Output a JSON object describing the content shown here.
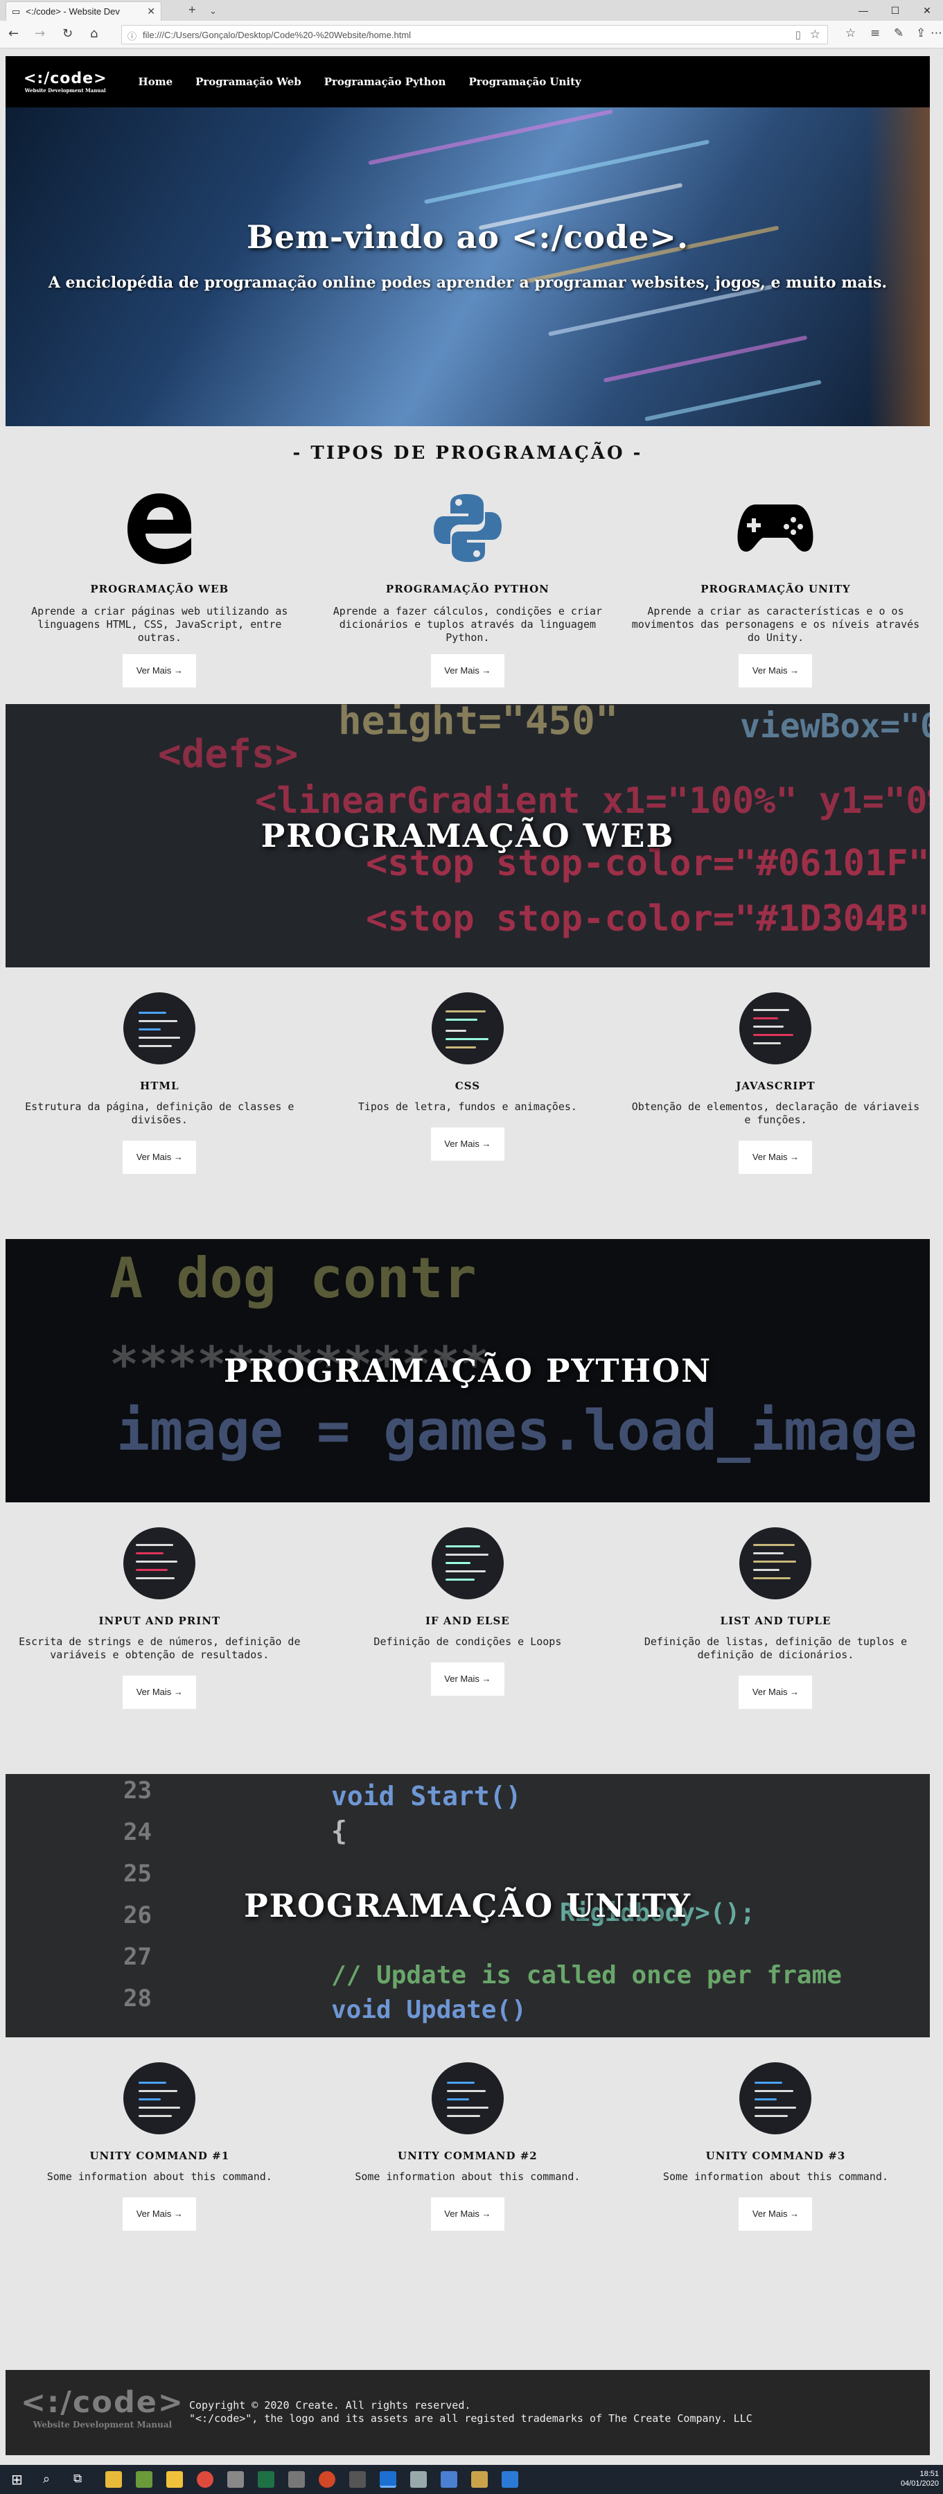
{
  "browser": {
    "tab_title": "<:/code> - Website Dev",
    "url": "file:///C:/Users/Gonçalo/Desktop/Code%20-%20Website/home.html"
  },
  "site": {
    "logo": {
      "title": "<:/code>",
      "subtitle": "Website Development Manual"
    },
    "nav": [
      "Home",
      "Programação Web",
      "Programação Python",
      "Programação Unity"
    ],
    "hero": {
      "title": "Bem-vindo ao <:/code>.",
      "subtitle": "A enciclopédia de programação online podes aprender a programar websites, jogos, e muito mais."
    },
    "types_heading": "- TIPOS DE PROGRAMAÇÃO -",
    "types": [
      {
        "icon": "edge-icon",
        "name": "PROGRAMAÇÃO WEB",
        "desc": "Aprende a criar páginas web utilizando as linguagens HTML, CSS, JavaScript, entre outras.",
        "button": "Ver Mais →"
      },
      {
        "icon": "python-icon",
        "name": "PROGRAMAÇÃO PYTHON",
        "desc": "Aprende a fazer cálculos, condições e criar dicionários e tuplos através da linguagem Python.",
        "button": "Ver Mais →"
      },
      {
        "icon": "gamepad-icon",
        "name": "PROGRAMAÇÃO UNITY",
        "desc": "Aprende a criar as características e o os movimentos das personagens e os níveis através do Unity.",
        "button": "Ver Mais →"
      }
    ],
    "web": {
      "banner": "PROGRAMAÇÃO WEB",
      "items": [
        {
          "name": "HTML",
          "desc": "Estrutura da página, definição de classes e divisões.",
          "button": "Ver Mais →"
        },
        {
          "name": "CSS",
          "desc": "Tipos de letra, fundos e animações.",
          "button": "Ver Mais →"
        },
        {
          "name": "JAVASCRIPT",
          "desc": "Obtenção de elementos, declaração de váriaveis e funções.",
          "button": "Ver Mais →"
        }
      ]
    },
    "python": {
      "banner": "PROGRAMAÇÃO PYTHON",
      "items": [
        {
          "name": "INPUT AND PRINT",
          "desc": "Escrita de strings e de números, definição de variáveis e obtenção de resultados.",
          "button": "Ver Mais →"
        },
        {
          "name": "IF AND ELSE",
          "desc": "Definição de condições e Loops",
          "button": "Ver Mais →"
        },
        {
          "name": "LIST AND TUPLE",
          "desc": "Definição de listas, definição de tuplos e definição de dicionários.",
          "button": "Ver Mais →"
        }
      ]
    },
    "unity": {
      "banner": "PROGRAMAÇÃO UNITY",
      "items": [
        {
          "name": "UNITY COMMAND #1",
          "desc": "Some information about this command.",
          "button": "Ver Mais →"
        },
        {
          "name": "UNITY COMMAND #2",
          "desc": "Some information about this command.",
          "button": "Ver Mais →"
        },
        {
          "name": "UNITY COMMAND #3",
          "desc": "Some information about this command.",
          "button": "Ver Mais →"
        }
      ]
    },
    "footer": {
      "logo_title": "<:/code>",
      "logo_subtitle": "Website Development Manual",
      "line1": "Copyright © 2020 Create. All rights reserved.",
      "line2": "\"<:/code>\", the logo and its assets are all registed trademarks of The Create Company. LLC"
    }
  },
  "taskbar": {
    "time": "18:51",
    "date": "04/01/2020"
  },
  "colors": {
    "navbar": "#000000",
    "page_bg": "#e6e6e6",
    "footer": "#262626",
    "python_blue": "#3d74a8"
  }
}
